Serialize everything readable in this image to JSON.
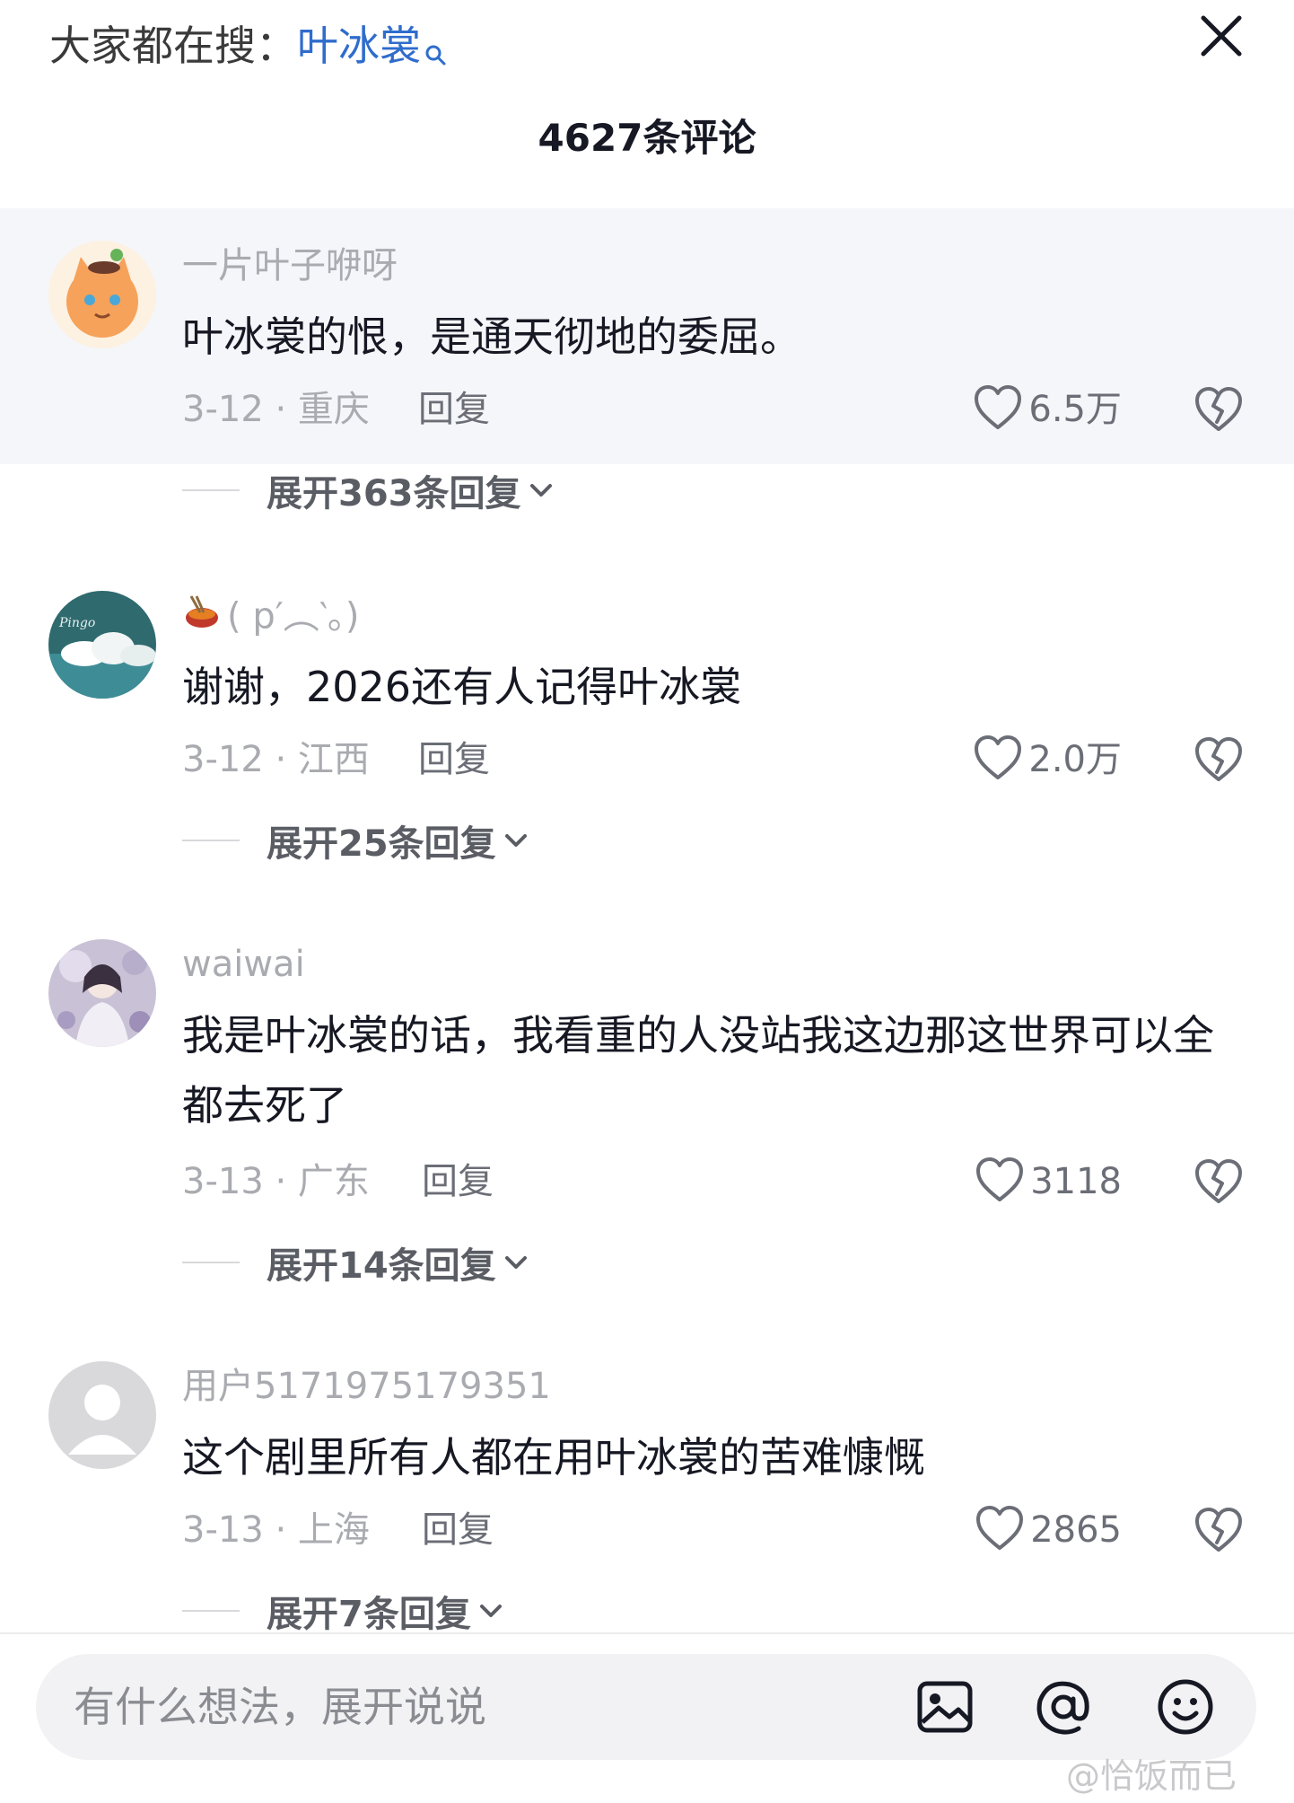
{
  "header": {
    "search_prefix": "大家都在搜：",
    "search_keyword": "叶冰裳",
    "comment_count": "4627条评论"
  },
  "comments": [
    {
      "username": "一片叶子咿呀",
      "text": "叶冰裳的恨，是通天彻地的委屈。",
      "date_location": "3-12 · 重庆",
      "reply_label": "回复",
      "likes": "6.5万",
      "expand_label": "展开363条回复"
    },
    {
      "username": "( p′︵‵。)",
      "text": "谢谢，2026还有人记得叶冰裳",
      "date_location": "3-12 · 江西",
      "reply_label": "回复",
      "likes": "2.0万",
      "expand_label": "展开25条回复"
    },
    {
      "username": "waiwai",
      "text": "我是叶冰裳的话，我看重的人没站我这边那这世界可以全都去死了",
      "date_location": "3-13 · 广东",
      "reply_label": "回复",
      "likes": "3118",
      "expand_label": "展开14条回复"
    },
    {
      "username": "用户5171975179351",
      "text": "这个剧里所有人都在用叶冰裳的苦难慷慨",
      "date_location": "3-13 · 上海",
      "reply_label": "回复",
      "likes": "2865",
      "expand_label": "展开7条回复"
    }
  ],
  "input": {
    "placeholder": "有什么想法，展开说说"
  },
  "watermark": "@恰饭而已",
  "colors": {
    "keyword": "#2f6dcc",
    "secondary_text": "#a9abb0",
    "highlight_bg": "#f5f6f9"
  }
}
